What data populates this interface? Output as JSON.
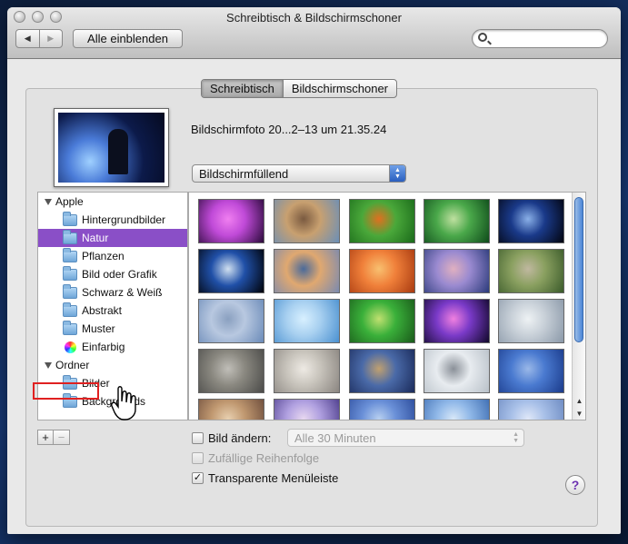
{
  "window": {
    "title": "Schreibtisch & Bildschirmschoner"
  },
  "toolbar": {
    "back_icon": "◀",
    "forward_icon": "▶",
    "show_all_label": "Alle einblenden",
    "search_placeholder": ""
  },
  "tabs": [
    {
      "label": "Schreibtisch",
      "active": true
    },
    {
      "label": "Bildschirmschoner",
      "active": false
    }
  ],
  "preview": {
    "photo_name": "Bildschirmfoto 20...2–13 um 21.35.24"
  },
  "fill_mode": {
    "selected": "Bildschirmfüllend"
  },
  "sources": {
    "group_apple": "Apple",
    "apple_items": [
      "Hintergrundbilder",
      "Natur",
      "Pflanzen",
      "Bild oder Grafik",
      "Schwarz & Weiß",
      "Abstrakt",
      "Muster",
      "Einfarbig"
    ],
    "selected_item": "Natur",
    "group_folders": "Ordner",
    "folder_items": [
      "Bilder",
      "Backgrounds"
    ]
  },
  "list_buttons": {
    "add": "+",
    "remove": "−"
  },
  "options": {
    "change_picture_label": "Bild ändern:",
    "change_picture_checked": false,
    "interval_value": "Alle 30 Minuten",
    "random_order_label": "Zufällige Reihenfolge",
    "random_order_checked": false,
    "translucent_menubar_label": "Transparente Menüleiste",
    "translucent_menubar_checked": true,
    "check_mark": "✓"
  },
  "help": {
    "label": "?"
  },
  "thumbnails": [
    {
      "name": "magenta-flower",
      "colors": [
        "#2a0a3a",
        "#c04ad8",
        "#f07ff0"
      ]
    },
    {
      "name": "mountain-valley",
      "colors": [
        "#6a8fb8",
        "#c8a070",
        "#7a5a40"
      ]
    },
    {
      "name": "clownfish-anemone",
      "colors": [
        "#1a6a1a",
        "#4aa83a",
        "#e07020"
      ]
    },
    {
      "name": "green-leaf-drop",
      "colors": [
        "#0e4a1a",
        "#4aa84a",
        "#bfe0a0"
      ]
    },
    {
      "name": "earth-horizon",
      "colors": [
        "#02040e",
        "#1a3a8a",
        "#8ab0e8"
      ]
    },
    {
      "name": "earth-globe",
      "colors": [
        "#000208",
        "#2050a8",
        "#d0e0f0"
      ]
    },
    {
      "name": "sunset-clouds",
      "colors": [
        "#7a8ab0",
        "#e0a870",
        "#4a6a9a"
      ]
    },
    {
      "name": "sand-dunes-orange",
      "colors": [
        "#a83a10",
        "#f0803a",
        "#f8c070"
      ]
    },
    {
      "name": "aurora-dunes",
      "colors": [
        "#2a3a7a",
        "#9a8ad0",
        "#e0b0c0"
      ]
    },
    {
      "name": "zen-garden",
      "colors": [
        "#3a5a2a",
        "#8aa060",
        "#c0b8a0"
      ]
    },
    {
      "name": "foggy-sea",
      "colors": [
        "#6a8ab8",
        "#b8c8e0",
        "#8aa0c0"
      ]
    },
    {
      "name": "ice-crystals",
      "colors": [
        "#4a90d0",
        "#a8d0f0",
        "#d8f0ff"
      ]
    },
    {
      "name": "ladybug-leaf",
      "colors": [
        "#1a5a1a",
        "#3ab03a",
        "#c0e070"
      ]
    },
    {
      "name": "purple-galaxy",
      "colors": [
        "#10082a",
        "#7a3ac8",
        "#f080e0"
      ]
    },
    {
      "name": "dandelion-seeds",
      "colors": [
        "#8a98a8",
        "#c8d0d8",
        "#eef2f4"
      ]
    },
    {
      "name": "stone-beach",
      "colors": [
        "#4a4a48",
        "#8a8880",
        "#c0beb8"
      ]
    },
    {
      "name": "pebbles",
      "colors": [
        "#8a8580",
        "#c8c4bc",
        "#eeeae4"
      ]
    },
    {
      "name": "leopard-rocks",
      "colors": [
        "#1a2a5a",
        "#4a6aa8",
        "#c0a070"
      ]
    },
    {
      "name": "snow-leopard",
      "colors": [
        "#b8c0c8",
        "#e8ecf0",
        "#8a9098"
      ]
    },
    {
      "name": "blue-waves",
      "colors": [
        "#1a3a8a",
        "#4a7ad0",
        "#9ab8e8"
      ]
    },
    {
      "name": "desert-rocks",
      "colors": [
        "#6a4a3a",
        "#c09870",
        "#e8d0b0"
      ]
    },
    {
      "name": "purple-sky",
      "colors": [
        "#4a3a8a",
        "#b0a0e0",
        "#e8d8f0"
      ]
    },
    {
      "name": "ocean-blue",
      "colors": [
        "#2a4a9a",
        "#6a90d8",
        "#b8d0f0"
      ]
    },
    {
      "name": "lake-reflection",
      "colors": [
        "#3a6ab0",
        "#90b8e8",
        "#d8e8f8"
      ]
    },
    {
      "name": "soft-clouds",
      "colors": [
        "#6a88c0",
        "#a8c0e8",
        "#e0e8f8"
      ]
    }
  ]
}
